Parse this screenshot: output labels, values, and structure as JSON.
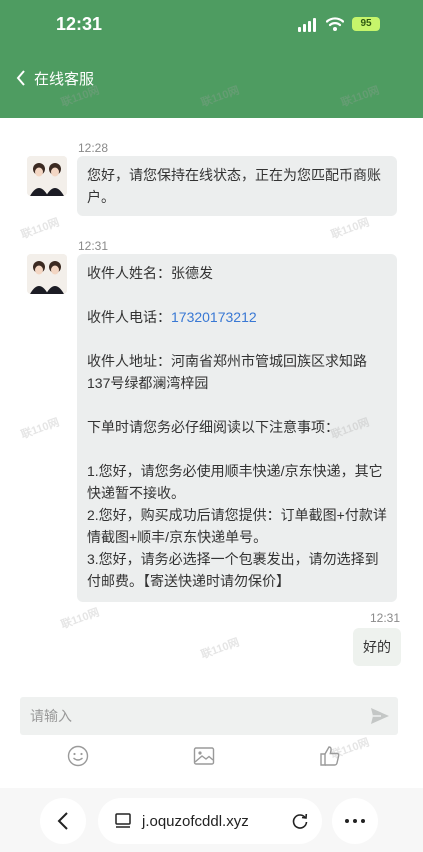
{
  "status": {
    "time": "12:31",
    "battery": "95"
  },
  "nav": {
    "back_label": "在线客服"
  },
  "messages": {
    "m1": {
      "time": "12:28",
      "text": "您好，请您保持在线状态，正在为您匹配币商账户。"
    },
    "m2": {
      "time": "12:31",
      "name_label": "收件人姓名：",
      "name_value": "张德发",
      "phone_label": "收件人电话：",
      "phone_value": "17320173212",
      "addr_label": "收件人地址：",
      "addr_value": "河南省郑州市管城回族区求知路137号绿都澜湾梓园",
      "notice_title": "下单时请您务必仔细阅读以下注意事项：",
      "notice_1": "1.您好，请您务必使用顺丰快递/京东快递，其它快递暂不接收。",
      "notice_2": "2.您好，购买成功后请您提供：订单截图+付款详情截图+顺丰/京东快递单号。",
      "notice_3": "3.您好，请务必选择一个包裹发出，请勿选择到付邮费。【寄送快递时请勿保价】"
    },
    "m3": {
      "time": "12:31",
      "text": "好的"
    }
  },
  "composer": {
    "placeholder": "请输入"
  },
  "browser": {
    "url": "j.oquzofcddl.xyz"
  },
  "watermark": "联110网",
  "colors": {
    "header": "#4e9c61",
    "bubble": "#eceeee",
    "link": "#3978d4"
  }
}
